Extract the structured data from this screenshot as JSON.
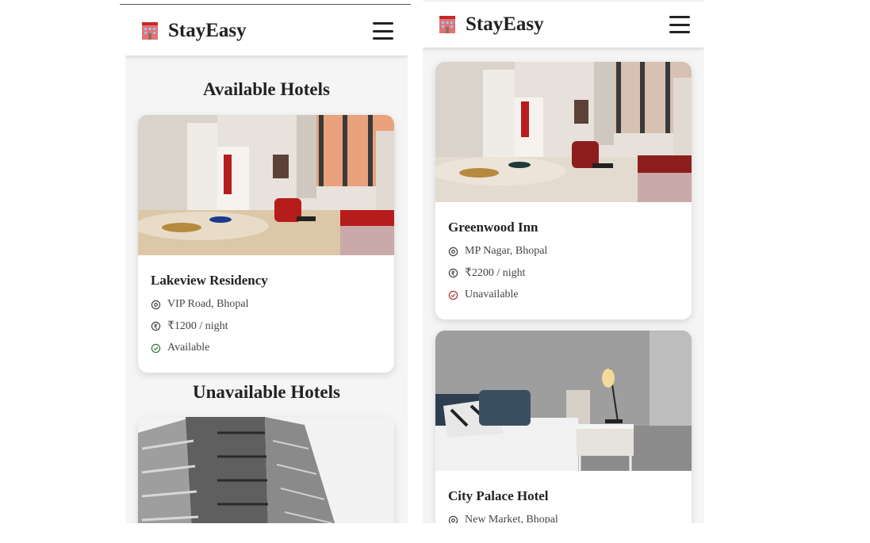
{
  "app": {
    "brand": "StayEasy",
    "brand_icon": "hotel-building-icon",
    "menu_icon": "hamburger-menu-icon"
  },
  "left_screen": {
    "available_title": "Available Hotels",
    "unavailable_title": "Unavailable Hotels",
    "available_hotels": [
      {
        "name": "Lakeview Residency",
        "location": "VIP Road, Bhopal",
        "price": "₹1200 / night",
        "status": "Available",
        "image": "modern-apartment-interior"
      }
    ],
    "unavailable_preview": {
      "image": "highrise-building-grayscale"
    }
  },
  "right_screen": {
    "hotels": [
      {
        "name": "Greenwood Inn",
        "location": "MP Nagar, Bhopal",
        "price": "₹2200 / night",
        "status": "Unavailable",
        "image": "modern-apartment-interior"
      },
      {
        "name": "City Palace Hotel",
        "location": "New Market, Bhopal",
        "image": "bedroom-with-lamp"
      }
    ]
  },
  "colors": {
    "available": "#2e7d32",
    "unavailable": "#a33333",
    "background": "#f5f5f5"
  }
}
